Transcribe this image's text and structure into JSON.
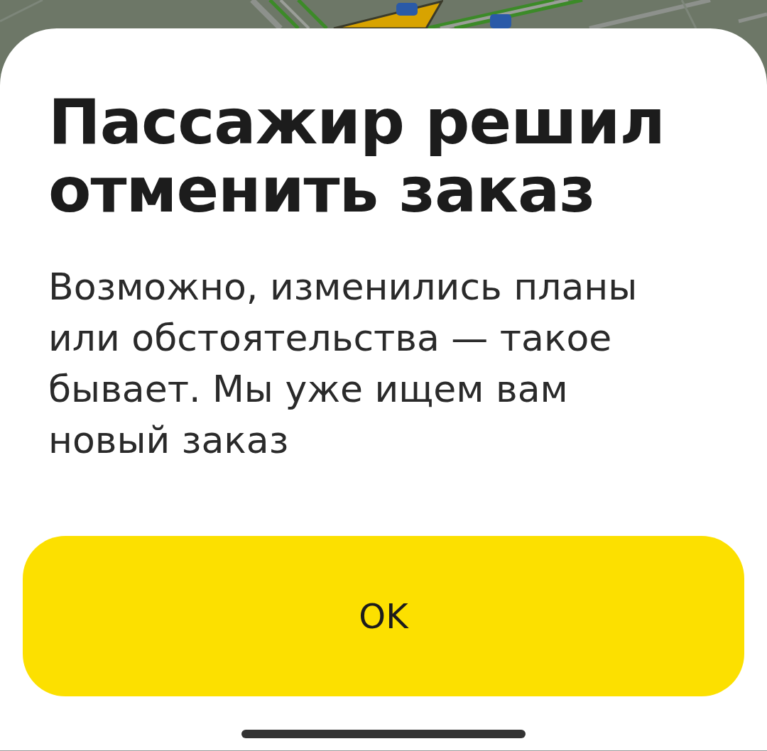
{
  "dialog": {
    "title": "Пассажир решил отменить заказ",
    "message": "Возможно, изменились планы или обстоятельства — такое бывает. Мы уже ищем вам новый заказ",
    "button": "OK"
  }
}
